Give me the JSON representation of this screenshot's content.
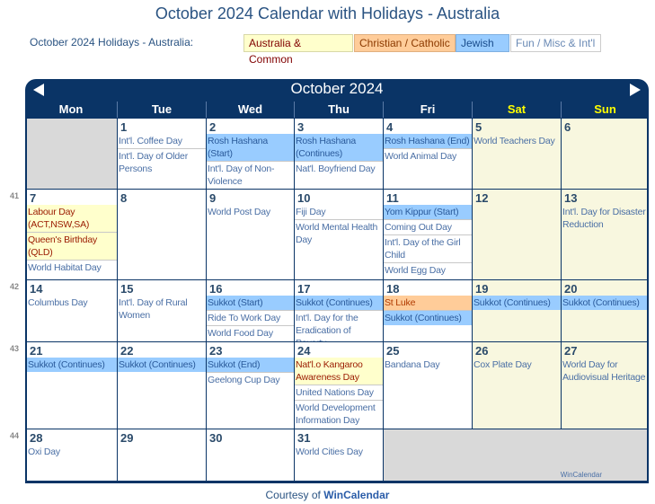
{
  "page_title": "October 2024 Calendar with Holidays - Australia",
  "legend": {
    "label": "October 2024 Holidays - Australia:",
    "items": [
      {
        "label": "Australia & Common",
        "category": "aus",
        "color": "#ffffcc"
      },
      {
        "label": "Christian / Catholic",
        "category": "chr",
        "color": "#ffcc99"
      },
      {
        "label": "Jewish",
        "category": "jew",
        "color": "#99ccff"
      },
      {
        "label": "Fun / Misc & Int'l",
        "category": "fun",
        "color": "#ffffff"
      }
    ]
  },
  "calendar": {
    "month_title": "October 2024",
    "prev_icon": "triangle-left-icon",
    "next_icon": "triangle-right-icon",
    "weekdays": [
      "Mon",
      "Tue",
      "Wed",
      "Thu",
      "Fri",
      "Sat",
      "Sun"
    ],
    "colors": {
      "header": "#0a3466",
      "weekend_label": "#ffff00",
      "weekend_bg": "#f8f7df",
      "empty_bg": "#d9d9d9"
    },
    "weeks": [
      {
        "week_number": "",
        "days": [
          {
            "day": "",
            "events": []
          },
          {
            "day": "1",
            "events": [
              {
                "name": "Int'l. Coffee Day",
                "cat": "fun"
              },
              {
                "name": "Int'l. Day of Older Persons",
                "cat": "fun"
              }
            ]
          },
          {
            "day": "2",
            "events": [
              {
                "name": "Rosh Hashana (Start)",
                "cat": "jew"
              },
              {
                "name": "Int'l. Day of Non-Violence",
                "cat": "fun"
              }
            ]
          },
          {
            "day": "3",
            "events": [
              {
                "name": "Rosh Hashana (Continues)",
                "cat": "jew"
              },
              {
                "name": "Nat'l. Boyfriend Day",
                "cat": "fun"
              }
            ]
          },
          {
            "day": "4",
            "events": [
              {
                "name": "Rosh Hashana (End)",
                "cat": "jew"
              },
              {
                "name": "World Animal Day",
                "cat": "fun"
              }
            ]
          },
          {
            "day": "5",
            "events": [
              {
                "name": "World Teachers Day",
                "cat": "fun"
              }
            ]
          },
          {
            "day": "6",
            "events": []
          }
        ]
      },
      {
        "week_number": "41",
        "days": [
          {
            "day": "7",
            "events": [
              {
                "name": "Labour Day (ACT,NSW,SA)",
                "cat": "aus"
              },
              {
                "name": "Queen's Birthday (QLD)",
                "cat": "aus"
              },
              {
                "name": "World Habitat Day",
                "cat": "fun"
              }
            ]
          },
          {
            "day": "8",
            "events": []
          },
          {
            "day": "9",
            "events": [
              {
                "name": "World Post Day",
                "cat": "fun"
              }
            ]
          },
          {
            "day": "10",
            "events": [
              {
                "name": "Fiji Day",
                "cat": "fun"
              },
              {
                "name": "World Mental Health Day",
                "cat": "fun"
              }
            ]
          },
          {
            "day": "11",
            "events": [
              {
                "name": "Yom Kippur (Start)",
                "cat": "jew"
              },
              {
                "name": "Coming Out Day",
                "cat": "fun"
              },
              {
                "name": "Int'l. Day of the Girl Child",
                "cat": "fun"
              },
              {
                "name": "World Egg Day",
                "cat": "fun"
              }
            ]
          },
          {
            "day": "12",
            "events": []
          },
          {
            "day": "13",
            "events": [
              {
                "name": "Int'l. Day for Disaster Reduction",
                "cat": "fun"
              }
            ]
          }
        ]
      },
      {
        "week_number": "42",
        "days": [
          {
            "day": "14",
            "events": [
              {
                "name": "Columbus Day",
                "cat": "fun"
              }
            ]
          },
          {
            "day": "15",
            "events": [
              {
                "name": "Int'l. Day of Rural Women",
                "cat": "fun"
              }
            ]
          },
          {
            "day": "16",
            "events": [
              {
                "name": "Sukkot (Start)",
                "cat": "jew"
              },
              {
                "name": "Ride To Work Day",
                "cat": "fun"
              },
              {
                "name": "World Food Day",
                "cat": "fun"
              }
            ]
          },
          {
            "day": "17",
            "events": [
              {
                "name": "Sukkot (Continues)",
                "cat": "jew"
              },
              {
                "name": "Int'l. Day for the Eradication of Poverty",
                "cat": "fun"
              }
            ]
          },
          {
            "day": "18",
            "events": [
              {
                "name": "St Luke",
                "cat": "chr"
              },
              {
                "name": "Sukkot (Continues)",
                "cat": "jew"
              }
            ]
          },
          {
            "day": "19",
            "events": [
              {
                "name": "Sukkot (Continues)",
                "cat": "jew"
              }
            ]
          },
          {
            "day": "20",
            "events": [
              {
                "name": "Sukkot (Continues)",
                "cat": "jew"
              }
            ]
          }
        ]
      },
      {
        "week_number": "43",
        "days": [
          {
            "day": "21",
            "events": [
              {
                "name": "Sukkot (Continues)",
                "cat": "jew"
              }
            ]
          },
          {
            "day": "22",
            "events": [
              {
                "name": "Sukkot (Continues)",
                "cat": "jew"
              }
            ]
          },
          {
            "day": "23",
            "events": [
              {
                "name": "Sukkot (End)",
                "cat": "jew"
              },
              {
                "name": "Geelong Cup Day",
                "cat": "fun"
              }
            ]
          },
          {
            "day": "24",
            "events": [
              {
                "name": "Nat'l.o Kangaroo Awareness Day",
                "cat": "aus"
              },
              {
                "name": "United Nations Day",
                "cat": "fun"
              },
              {
                "name": "World Development Information Day",
                "cat": "fun"
              }
            ]
          },
          {
            "day": "25",
            "events": [
              {
                "name": "Bandana Day",
                "cat": "fun"
              }
            ]
          },
          {
            "day": "26",
            "events": [
              {
                "name": "Cox Plate Day",
                "cat": "fun"
              }
            ]
          },
          {
            "day": "27",
            "events": [
              {
                "name": "World Day for Audiovisual Heritage",
                "cat": "fun"
              }
            ]
          }
        ]
      },
      {
        "week_number": "44",
        "days": [
          {
            "day": "28",
            "events": [
              {
                "name": "Oxi Day",
                "cat": "fun"
              }
            ]
          },
          {
            "day": "29",
            "events": []
          },
          {
            "day": "30",
            "events": []
          },
          {
            "day": "31",
            "events": [
              {
                "name": "World Cities Day",
                "cat": "fun"
              }
            ]
          }
        ]
      }
    ],
    "watermark": "WinCalendar"
  },
  "footer": {
    "prefix": "Courtesy of",
    "link": "WinCalendar"
  }
}
